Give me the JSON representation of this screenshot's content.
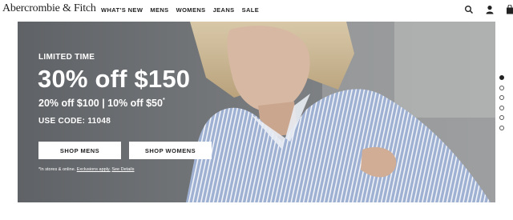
{
  "brand": {
    "name": "Abercrombie & Fitch"
  },
  "nav": {
    "items": [
      {
        "label": "WHAT'S NEW"
      },
      {
        "label": "MENS"
      },
      {
        "label": "WOMENS"
      },
      {
        "label": "JEANS"
      },
      {
        "label": "SALE"
      }
    ]
  },
  "header_icons": [
    "search-icon",
    "account-icon",
    "shopping-bag-icon"
  ],
  "hero": {
    "eyebrow": "LIMITED TIME",
    "headline": "30% off $150",
    "subline": "20% off $100  |  10% off $50",
    "subline_mark": "*",
    "code": "USE CODE: 11048",
    "buttons": {
      "mens": "SHOP MENS",
      "womens": "SHOP WOMENS"
    },
    "disclaimer_prefix": "*In stores & online. ",
    "disclaimer_link1": "Exclusions apply.",
    "disclaimer_link2": "See Details"
  },
  "carousel": {
    "slides": 6,
    "active": 0
  },
  "colors": {
    "text": "#222222",
    "hero_bg": "#6b6e72",
    "shirt": "#8fa3c8",
    "white": "#ffffff"
  }
}
